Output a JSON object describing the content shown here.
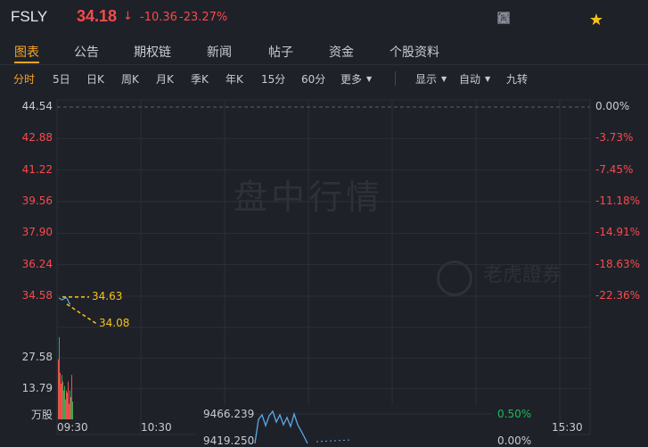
{
  "header": {
    "symbol": "FSLY",
    "price": "34.18",
    "arrow": "↓",
    "change": "-10.36",
    "change_pct": "-23.27%",
    "icons": [
      "refresh-icon",
      "bell-icon",
      "grid-icon",
      "star-icon"
    ],
    "colors": {
      "down": "#f74b4b",
      "up": "#1db954",
      "accent": "#f5a623",
      "star": "#f5c518"
    }
  },
  "tabs": [
    "图表",
    "公告",
    "期权链",
    "新闻",
    "帖子",
    "资金",
    "个股资料"
  ],
  "toolbar": {
    "periods": [
      "分时",
      "5日",
      "日K",
      "周K",
      "月K",
      "季K",
      "年K",
      "15分",
      "60分"
    ],
    "more": "更多",
    "display": "显示",
    "auto": "自动",
    "nine": "九转"
  },
  "watermark": {
    "main": "盘中行情",
    "brand": "老虎證券"
  },
  "chart_data": {
    "type": "line",
    "y_left_ticks": [
      "44.54",
      "42.88",
      "41.22",
      "39.56",
      "37.90",
      "36.24",
      "34.58"
    ],
    "y_right_ticks": [
      "0.00%",
      "-3.73%",
      "-7.45%",
      "-11.18%",
      "-14.91%",
      "-18.63%",
      "-22.36%"
    ],
    "price_series": [
      34.58,
      34.55,
      34.5,
      34.48,
      34.52,
      34.56,
      34.6,
      34.55,
      34.45,
      34.3,
      34.25
    ],
    "annotations": [
      {
        "label": "34.63",
        "value": 34.63
      },
      {
        "label": "34.08",
        "value": 34.08
      }
    ],
    "volume_ticks": [
      "27.58",
      "13.79"
    ],
    "volume_unit": "万股",
    "volume_bars": [
      27,
      37,
      21,
      16,
      20,
      17,
      13,
      15,
      9,
      13,
      12,
      17,
      7,
      13,
      10,
      20,
      8
    ],
    "volume_colors": [
      "#f74b4b",
      "#1db954"
    ],
    "x_ticks": [
      "09:30",
      "10:30",
      "15:30"
    ],
    "index_overlay": {
      "y_ticks": [
        "9466.239",
        "9419.250"
      ],
      "right_ticks": [
        "0.50%",
        "0.00%"
      ]
    }
  }
}
